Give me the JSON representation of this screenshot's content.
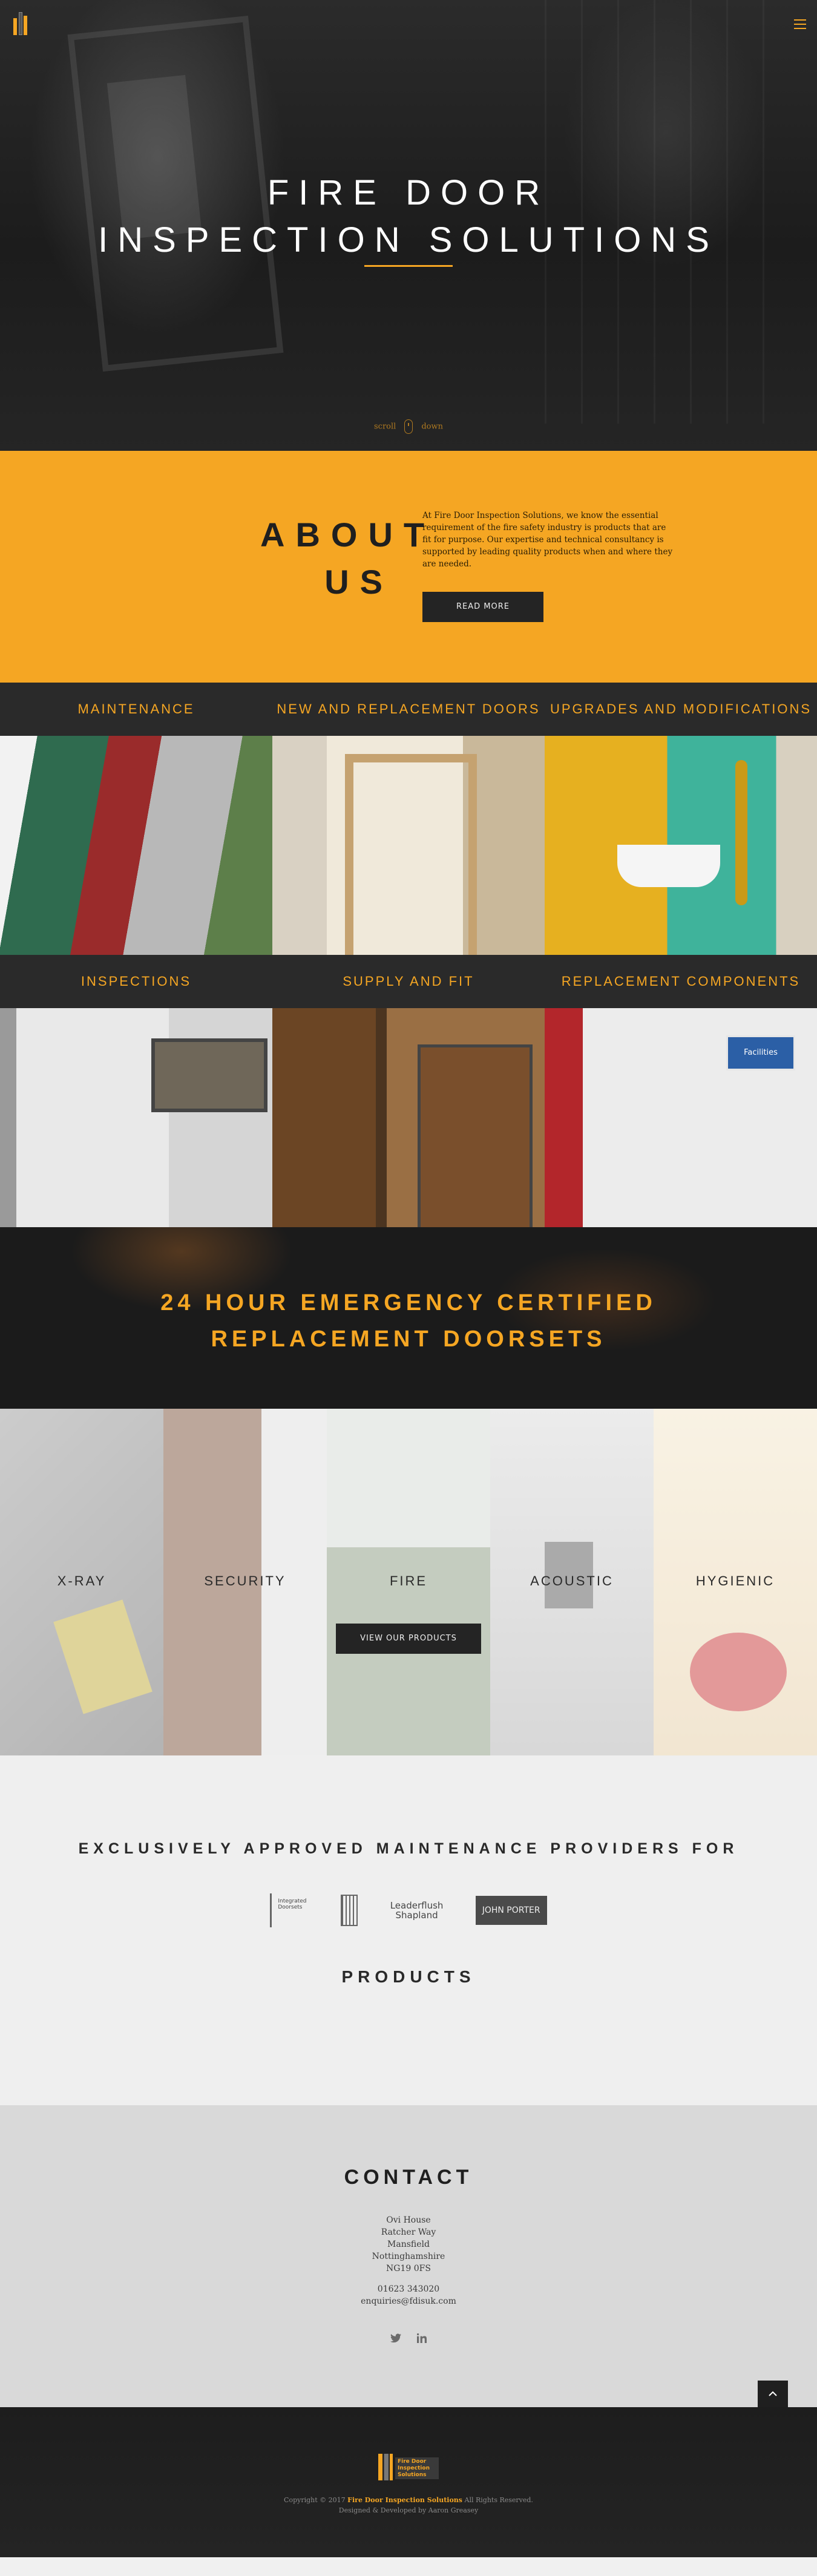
{
  "header": {
    "menu_icon": "hamburger-icon"
  },
  "hero": {
    "title_line1": "FIRE DOOR",
    "title_line2": "INSPECTION SOLUTIONS",
    "scroll_left": "scroll",
    "scroll_right": "down"
  },
  "about": {
    "title_line1": "ABOUT",
    "title_line2": "US",
    "text": "At Fire Door Inspection Solutions, we know the essential requirement of the fire safety industry is products that are fit for purpose. Our expertise and technical consultancy is supported by leading quality products when and where they are needed.",
    "button": "READ MORE"
  },
  "services": [
    {
      "label": "MAINTENANCE"
    },
    {
      "label": "NEW AND REPLACEMENT DOORS"
    },
    {
      "label": "UPGRADES AND MODIFICATIONS"
    },
    {
      "label": "INSPECTIONS"
    },
    {
      "label": "SUPPLY AND FIT"
    },
    {
      "label": "REPLACEMENT COMPONENTS"
    }
  ],
  "services_image_text": "Facilities",
  "emergency": {
    "line1": "24 HOUR EMERGENCY CERTIFIED",
    "line2": "REPLACEMENT DOORSETS"
  },
  "products": {
    "items": [
      "X-RAY",
      "SECURITY",
      "FIRE",
      "ACOUSTIC",
      "HYGIENIC"
    ],
    "button": "VIEW OUR PRODUCTS"
  },
  "approved": {
    "title": "EXCLUSIVELY APPROVED MAINTENANCE PROVIDERS FOR",
    "logos": [
      "Integrated Doorsets",
      "Leaderflush Shapland",
      "JOHN PORTER"
    ],
    "products_title": "PRODUCTS"
  },
  "contact": {
    "title": "CONTACT",
    "address": [
      "Ovi House",
      "Ratcher Way",
      "Mansfield",
      "Nottinghamshire",
      "NG19 0FS"
    ],
    "phone": "01623 343020",
    "email": "enquiries@fdisuk.com",
    "social_icons": [
      "twitter-icon",
      "linkedin-icon"
    ],
    "back_to_top_icon": "chevron-up-icon"
  },
  "footer": {
    "logo_text": "Fire Door Inspection Solutions",
    "copyright_prefix": "Copyright © 2017",
    "copyright_brand": "Fire Door Inspection Solutions",
    "copyright_suffix": "All Rights Reserved.",
    "credit": "Designed & Developed by Aaron Greasey"
  },
  "colors": {
    "accent": "#f5a623",
    "dark": "#1f1f1f",
    "light": "#efefef"
  }
}
